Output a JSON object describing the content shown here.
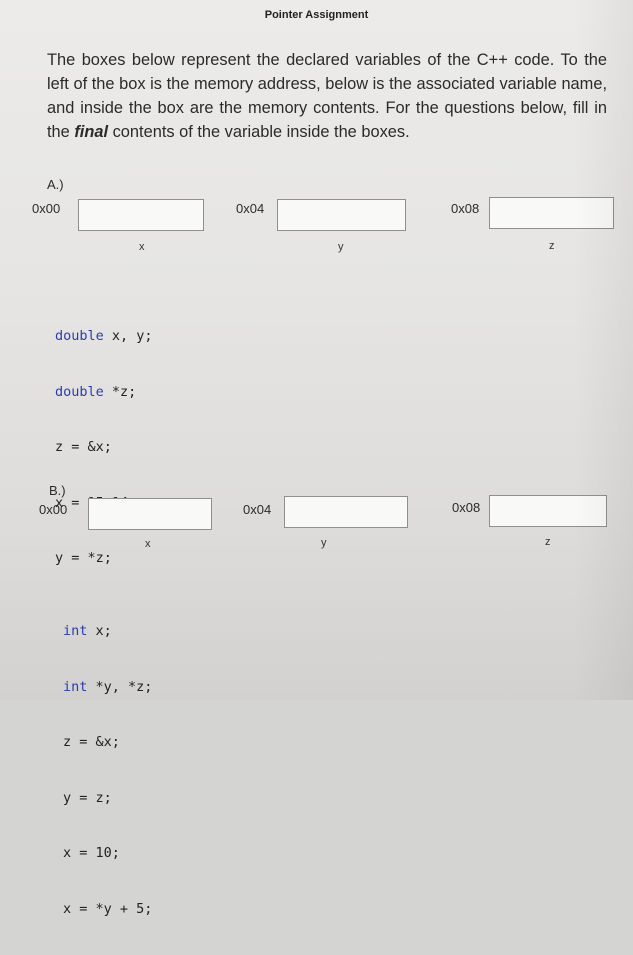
{
  "document": {
    "title": "Pointer Assignment",
    "intro_before_emphasis": "The boxes below represent the declared variables of the C++ code. To the left of the box is the memory address, below is the associated variable name, and inside the box are the memory contents. For the questions below, fill in the ",
    "intro_emphasis": "final",
    "intro_after_emphasis": " contents of the variable inside the boxes."
  },
  "sections": [
    {
      "label": "A.)",
      "variables": [
        {
          "address": "0x00",
          "name": "x",
          "contents": ""
        },
        {
          "address": "0x04",
          "name": "y",
          "contents": ""
        },
        {
          "address": "0x08",
          "name": "z",
          "contents": ""
        }
      ],
      "code": [
        {
          "keyword": "double",
          "rest": " x, y;"
        },
        {
          "keyword": "double",
          "rest": " *z;"
        },
        {
          "keyword": "",
          "rest": "z = &x;"
        },
        {
          "keyword": "",
          "rest": "x = 15.14;"
        },
        {
          "keyword": "",
          "rest": "y = *z;"
        }
      ]
    },
    {
      "label": "B.)",
      "variables": [
        {
          "address": "0x00",
          "name": "x",
          "contents": ""
        },
        {
          "address": "0x04",
          "name": "y",
          "contents": ""
        },
        {
          "address": "0x08",
          "name": "z",
          "contents": ""
        }
      ],
      "code": [
        {
          "keyword": "int",
          "rest": " x;"
        },
        {
          "keyword": "int",
          "rest": " *y, *z;"
        },
        {
          "keyword": "",
          "rest": "z = &x;"
        },
        {
          "keyword": "",
          "rest": "y = z;"
        },
        {
          "keyword": "",
          "rest": "x = 10;"
        },
        {
          "keyword": "",
          "rest": "x = *y + 5;"
        }
      ]
    }
  ],
  "colors": {
    "keyword": "#2a3bb0",
    "text": "#2b2b2b"
  }
}
